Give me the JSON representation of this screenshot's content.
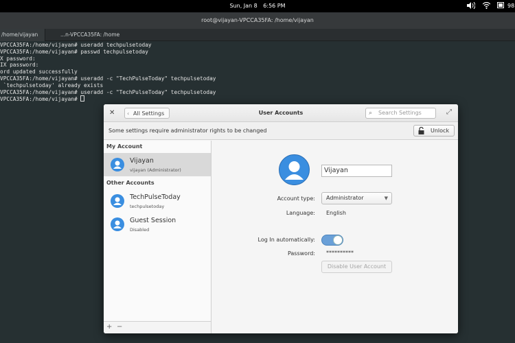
{
  "panel": {
    "date": "Sun, Jan  8",
    "time": "6:56 PM",
    "battery": "98"
  },
  "terminal": {
    "title": "root@vijayan-VPCCA35FA: /home/vijayan",
    "tabs": [
      "/home/vijayan",
      "...n-VPCCA35FA: /home"
    ],
    "lines": [
      "VPCCA35FA:/home/vijayan# useradd techpulsetoday",
      "VPCCA35FA:/home/vijayan# passwd techpulsetoday",
      "X password:",
      "IX password:",
      "ord updated successfully",
      "VPCCA35FA:/home/vijayan# useradd -c \"TechPulseToday\" techpulsetoday",
      " `techpulsetoday' already exists",
      "VPCCA35FA:/home/vijayan# useradd -c \"TechPulseToday\" techpulsetoday",
      "VPCCA35FA:/home/vijayan# "
    ]
  },
  "dialog": {
    "title": "User Accounts",
    "back_label": "All Settings",
    "search_placeholder": "Search Settings",
    "info_message": "Some settings require administrator rights to be changed",
    "unlock_label": "Unlock",
    "sidebar": {
      "my_account_header": "My Account",
      "other_accounts_header": "Other Accounts",
      "users": [
        {
          "name": "Vijayan",
          "sub": "vijayan  (Administrator)"
        },
        {
          "name": "TechPulseToday",
          "sub": "techpulsetoday"
        },
        {
          "name": "Guest Session",
          "sub": "Disabled"
        }
      ],
      "add_label": "+",
      "remove_label": "−"
    },
    "details": {
      "full_name": "Vijayan",
      "account_type_label": "Account type:",
      "account_type_value": "Administrator",
      "language_label": "Language:",
      "language_value": "English",
      "autologin_label": "Log In automatically:",
      "autologin_on": true,
      "password_label": "Password:",
      "password_value": "**********",
      "disable_label": "Disable User Account"
    }
  },
  "colors": {
    "avatar_blue": "#3a8ee0",
    "toggle_on": "#6aa0d8"
  }
}
